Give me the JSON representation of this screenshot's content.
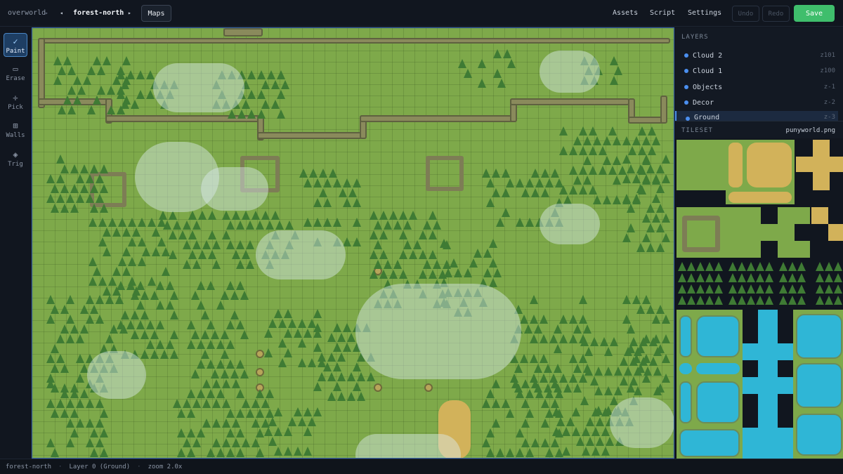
{
  "breadcrumb": {
    "root": "overworld",
    "separator": "▸",
    "prev_arrow": "◂",
    "current": "forest-north",
    "next_arrow": "▸"
  },
  "toolbar_top": {
    "maps_label": "Maps",
    "assets_label": "Assets",
    "script_label": "Script",
    "settings_label": "Settings",
    "undo_label": "Undo",
    "redo_label": "Redo",
    "save_label": "Save"
  },
  "tools": [
    {
      "label": "Paint",
      "icon": "pencil-icon",
      "glyph": "✓",
      "active": true
    },
    {
      "label": "Erase",
      "icon": "eraser-icon",
      "glyph": "▭",
      "active": false
    },
    {
      "label": "Pick",
      "icon": "crosshair-icon",
      "glyph": "✛",
      "active": false
    },
    {
      "label": "Walls",
      "icon": "grid-icon",
      "glyph": "⊞",
      "active": false
    },
    {
      "label": "Trig",
      "icon": "diamond-icon",
      "glyph": "◈",
      "active": false
    }
  ],
  "layers": {
    "title": "LAYERS",
    "items": [
      {
        "name": "Cloud 2",
        "z": "z101"
      },
      {
        "name": "Cloud 1",
        "z": "z100"
      },
      {
        "name": "Objects",
        "z": "z-1"
      },
      {
        "name": "Decor",
        "z": "z-2"
      },
      {
        "name": "Ground",
        "z": "z-3",
        "selected": true
      }
    ]
  },
  "tileset": {
    "title": "TILESET",
    "file": "punyworld.png"
  },
  "status": {
    "map": "forest-north",
    "layer": "Layer 0 (Ground)",
    "zoom": "zoom 2.0x"
  },
  "colors": {
    "accent": "#4b8ff0",
    "save": "#3fbe6c",
    "grass": "#7ea94a",
    "tree": "#3f7b34",
    "water": "#2fb6d6"
  }
}
